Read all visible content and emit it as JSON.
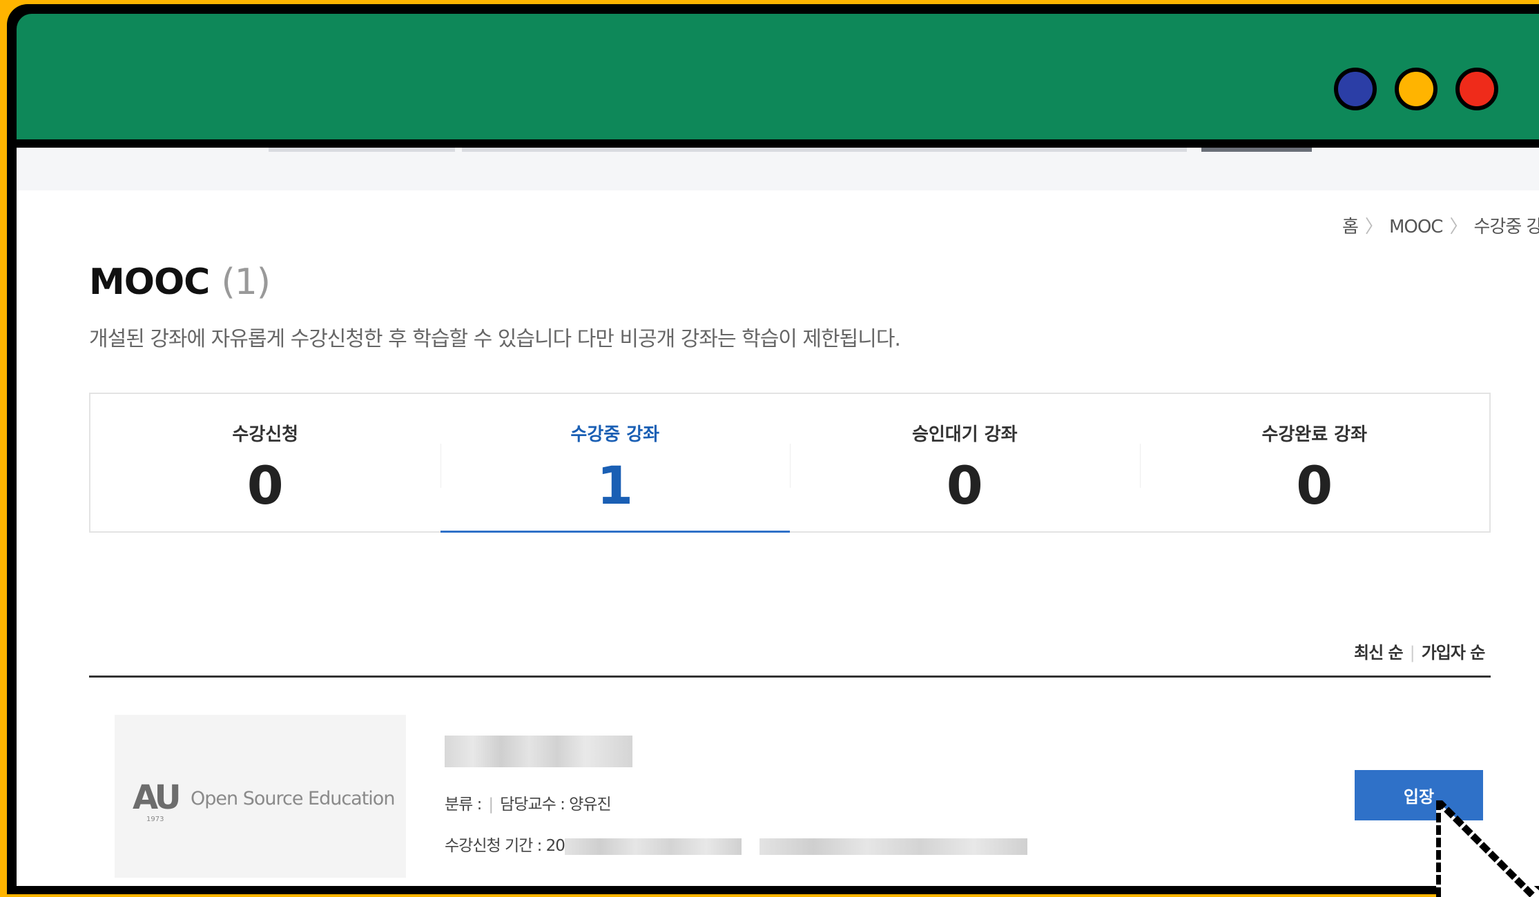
{
  "window": {
    "controls": [
      {
        "name": "blue",
        "color": "#2b3ea6"
      },
      {
        "name": "yellow",
        "color": "#ffb400"
      },
      {
        "name": "red",
        "color": "#ef2b1a"
      }
    ],
    "titlebar_color": "#0e8859"
  },
  "breadcrumb": [
    "홈",
    "MOOC",
    "수강중 강좌"
  ],
  "page": {
    "title": "MOOC",
    "count": "(1)",
    "description": "개설된 강좌에 자유롭게 수강신청한 후 학습할 수 있습니다 다만 비공개 강좌는 학습이 제한됩니다."
  },
  "stats": [
    {
      "label": "수강신청",
      "value": "0"
    },
    {
      "label": "수강중 강좌",
      "value": "1",
      "active": true
    },
    {
      "label": "승인대기 강좌",
      "value": "0"
    },
    {
      "label": "수강완료 강좌",
      "value": "0"
    }
  ],
  "sort": {
    "latest": "최신 순",
    "members": "가입자 순"
  },
  "course": {
    "thumbnail": {
      "logo": "AU",
      "year": "1973",
      "text": "Open Source Education"
    },
    "category_label": "분류 :",
    "professor": "담당교수 : 양유진",
    "period_label": "수강신청 기간 : 20",
    "enter_button": "입장"
  }
}
